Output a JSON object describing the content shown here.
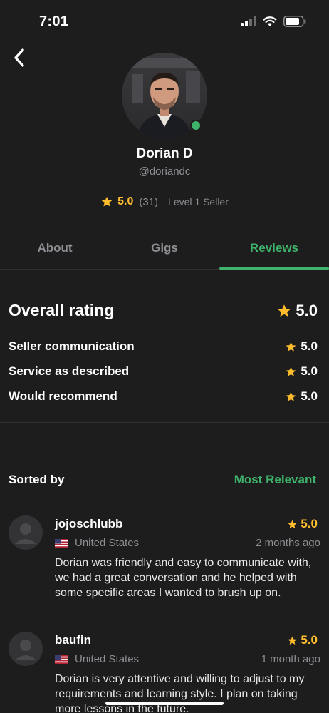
{
  "status_bar": {
    "time": "7:01",
    "icons": [
      "cellular-signal-icon",
      "wifi-icon",
      "battery-icon"
    ]
  },
  "colors": {
    "background": "#1d1d1e",
    "accent": "#3fb36b",
    "star": "#ffbd2e",
    "muted": "#8e8e93"
  },
  "profile": {
    "name": "Dorian D",
    "handle": "@doriandc",
    "rating": "5.0",
    "review_count": "(31)",
    "level": "Level 1 Seller",
    "online": true
  },
  "tabs": [
    {
      "label": "About",
      "active": false
    },
    {
      "label": "Gigs",
      "active": false
    },
    {
      "label": "Reviews",
      "active": true
    }
  ],
  "ratings": {
    "overall_label": "Overall rating",
    "overall_value": "5.0",
    "breakdown": [
      {
        "label": "Seller communication",
        "value": "5.0"
      },
      {
        "label": "Service as described",
        "value": "5.0"
      },
      {
        "label": "Would recommend",
        "value": "5.0"
      }
    ]
  },
  "sort": {
    "label": "Sorted by",
    "value": "Most Relevant"
  },
  "reviews": [
    {
      "user": "jojoschlubb",
      "country": "United States",
      "rating": "5.0",
      "time": "2 months ago",
      "text": "Dorian was friendly and easy to communicate with, we had a great conversation and he helped with some specific areas I wanted to brush up on."
    },
    {
      "user": "baufin",
      "country": "United States",
      "rating": "5.0",
      "time": "1 month ago",
      "text": "Dorian is very attentive and willing to adjust to my requirements and learning style. I plan on taking more lessons in the future."
    }
  ]
}
